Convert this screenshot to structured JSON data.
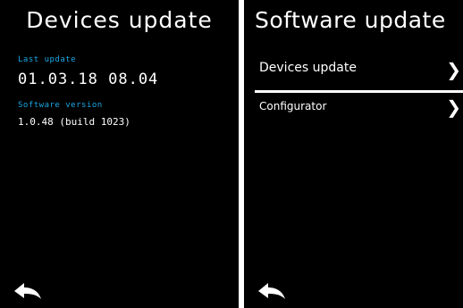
{
  "left_screen": {
    "title": "Devices update",
    "last_update": {
      "label": "Last update",
      "value": "01.03.18 08.04"
    },
    "software_version": {
      "label": "Software version",
      "value": "1.0.48 (build 1023)"
    },
    "back_icon": "back-arrow-icon"
  },
  "right_screen": {
    "title": "Software update",
    "menu_items": [
      {
        "label": "Devices update",
        "icon": "chevron-right-icon"
      },
      {
        "label": "Configurator",
        "icon": "chevron-right-icon"
      }
    ],
    "back_icon": "back-arrow-icon"
  },
  "colors": {
    "screen_background": "#000000",
    "text": "#ffffff",
    "accent_label": "#1aa9e6",
    "bezel": "#ffffff"
  }
}
